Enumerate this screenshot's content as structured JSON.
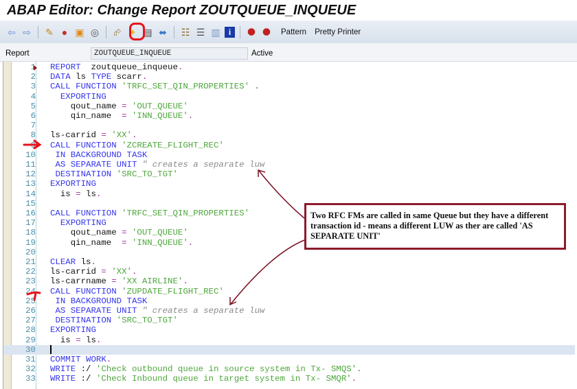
{
  "title": "ABAP Editor: Change Report ZOUTQUEUE_INQUEUE",
  "toolbar": {
    "icons": [
      "back-icon",
      "forward-icon",
      "display-change-icon",
      "activate-icon",
      "object-list-icon",
      "where-used-icon",
      "navigate-icon",
      "breakpoint-icon",
      "display-object-list-icon",
      "pattern-icon",
      "hierarchy-icon",
      "stack-icon",
      "layout-icon",
      "info-icon",
      "stop-icon",
      "stop-user-icon"
    ],
    "pattern_label": "Pattern",
    "pretty_printer_label": "Pretty Printer"
  },
  "report": {
    "label": "Report",
    "value": "ZOUTQUEUE_INQUEUE",
    "status": "Active"
  },
  "code": [
    [
      [
        "kw",
        "REPORT"
      ],
      [
        "txt",
        "  zoutqueue_inqueue"
      ],
      [
        "op",
        "."
      ]
    ],
    [
      [
        "kw",
        "DATA"
      ],
      [
        "txt",
        " ls "
      ],
      [
        "kw",
        "TYPE"
      ],
      [
        "txt",
        " scarr"
      ],
      [
        "op",
        "."
      ]
    ],
    [
      [
        "kw",
        "CALL FUNCTION"
      ],
      [
        "txt",
        " "
      ],
      [
        "str",
        "'TRFC_SET_QIN_PROPERTIES'"
      ],
      [
        "txt",
        " "
      ],
      [
        "op",
        "."
      ]
    ],
    [
      [
        "txt",
        "  "
      ],
      [
        "kw",
        "EXPORTING"
      ]
    ],
    [
      [
        "txt",
        "    qout_name "
      ],
      [
        "op",
        "="
      ],
      [
        "txt",
        " "
      ],
      [
        "str",
        "'OUT_QUEUE'"
      ]
    ],
    [
      [
        "txt",
        "    qin_name  "
      ],
      [
        "op",
        "="
      ],
      [
        "txt",
        " "
      ],
      [
        "str",
        "'INN_QUEUE'"
      ],
      [
        "op",
        "."
      ]
    ],
    [],
    [
      [
        "txt",
        "ls-carrid "
      ],
      [
        "op",
        "="
      ],
      [
        "txt",
        " "
      ],
      [
        "str",
        "'XX'"
      ],
      [
        "op",
        "."
      ]
    ],
    [
      [
        "kw",
        "CALL FUNCTION"
      ],
      [
        "txt",
        " "
      ],
      [
        "str",
        "'ZCREATE_FLIGHT_REC'"
      ]
    ],
    [
      [
        "txt",
        " "
      ],
      [
        "kw",
        "IN BACKGROUND TASK"
      ]
    ],
    [
      [
        "txt",
        " "
      ],
      [
        "kw",
        "AS SEPARATE UNIT"
      ],
      [
        "txt",
        " "
      ],
      [
        "cm",
        "\" creates a separate luw"
      ]
    ],
    [
      [
        "txt",
        " "
      ],
      [
        "kw",
        "DESTINATION"
      ],
      [
        "txt",
        " "
      ],
      [
        "str",
        "'SRC_TO_TGT'"
      ]
    ],
    [
      [
        "kw",
        "EXPORTING"
      ]
    ],
    [
      [
        "txt",
        "  is "
      ],
      [
        "op",
        "="
      ],
      [
        "txt",
        " ls"
      ],
      [
        "op",
        "."
      ]
    ],
    [],
    [
      [
        "kw",
        "CALL FUNCTION"
      ],
      [
        "txt",
        " "
      ],
      [
        "str",
        "'TRFC_SET_QIN_PROPERTIES'"
      ]
    ],
    [
      [
        "txt",
        "  "
      ],
      [
        "kw",
        "EXPORTING"
      ]
    ],
    [
      [
        "txt",
        "    qout_name "
      ],
      [
        "op",
        "="
      ],
      [
        "txt",
        " "
      ],
      [
        "str",
        "'OUT_QUEUE'"
      ]
    ],
    [
      [
        "txt",
        "    qin_name  "
      ],
      [
        "op",
        "="
      ],
      [
        "txt",
        " "
      ],
      [
        "str",
        "'INN_QUEUE'"
      ],
      [
        "op",
        "."
      ]
    ],
    [],
    [
      [
        "kw",
        "CLEAR"
      ],
      [
        "txt",
        " ls"
      ],
      [
        "op",
        "."
      ]
    ],
    [
      [
        "txt",
        "ls-carrid "
      ],
      [
        "op",
        "="
      ],
      [
        "txt",
        " "
      ],
      [
        "str",
        "'XX'"
      ],
      [
        "op",
        "."
      ]
    ],
    [
      [
        "txt",
        "ls-carrname "
      ],
      [
        "op",
        "="
      ],
      [
        "txt",
        " "
      ],
      [
        "str",
        "'XX AIRLINE'"
      ],
      [
        "op",
        "."
      ]
    ],
    [
      [
        "kw",
        "CALL FUNCTION"
      ],
      [
        "txt",
        " "
      ],
      [
        "str",
        "'ZUPDATE_FLIGHT_REC'"
      ]
    ],
    [
      [
        "txt",
        " "
      ],
      [
        "kw",
        "IN BACKGROUND TASK"
      ]
    ],
    [
      [
        "txt",
        " "
      ],
      [
        "kw",
        "AS SEPARATE UNIT"
      ],
      [
        "txt",
        " "
      ],
      [
        "cm",
        "\" creates a separate luw"
      ]
    ],
    [
      [
        "txt",
        " "
      ],
      [
        "kw",
        "DESTINATION"
      ],
      [
        "txt",
        " "
      ],
      [
        "str",
        "'SRC_TO_TGT'"
      ]
    ],
    [
      [
        "kw",
        "EXPORTING"
      ]
    ],
    [
      [
        "txt",
        "  is "
      ],
      [
        "op",
        "="
      ],
      [
        "txt",
        " ls"
      ],
      [
        "op",
        "."
      ]
    ],
    [],
    [
      [
        "kw",
        "COMMIT WORK"
      ],
      [
        "op",
        "."
      ]
    ],
    [
      [
        "kw",
        "WRITE"
      ],
      [
        "txt",
        " :/ "
      ],
      [
        "str",
        "'Check outbound queue in source system in Tx- SMQS'"
      ],
      [
        "op",
        "."
      ]
    ],
    [
      [
        "kw",
        "WRITE"
      ],
      [
        "txt",
        " :/ "
      ],
      [
        "str",
        "'Check Inbound queue in target system in Tx- SMQR'"
      ],
      [
        "op",
        "."
      ]
    ]
  ],
  "cursor_line": 30,
  "annotation": "Two RFC FMs are called in same Queue but they have a different transaction id - means a different LUW as ther are called 'AS SEPARATE UNIT'",
  "colors": {
    "keyword": "#3434ee",
    "string": "#4ea63c",
    "comment": "#8a8a8a",
    "operator": "#9c2f9c",
    "annotation_border": "#8b1a2a",
    "highlight": "#e8141c"
  }
}
